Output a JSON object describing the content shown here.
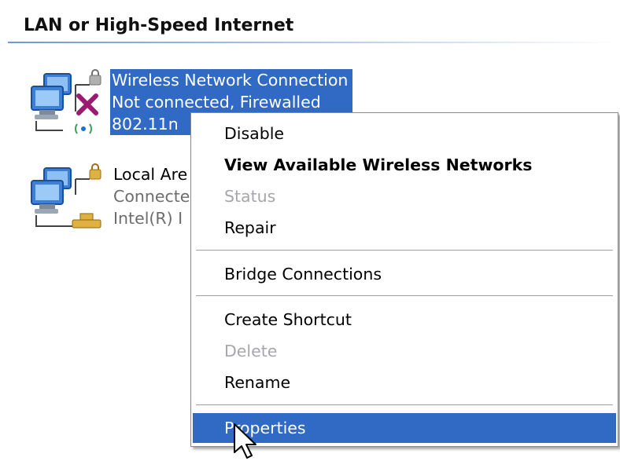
{
  "section": {
    "title": "LAN or High-Speed Internet"
  },
  "connections": [
    {
      "name": "Wireless Network Connection",
      "status": "Not connected, Firewalled",
      "device": "802.11n",
      "selected": true,
      "icon": "wireless-network-icon"
    },
    {
      "name": "Local Are",
      "status": "Connecte",
      "device": "Intel(R) I",
      "selected": false,
      "icon": "lan-network-icon"
    }
  ],
  "context_menu": {
    "items": [
      {
        "label": "Disable",
        "bold": false,
        "disabled": false
      },
      {
        "label": "View Available Wireless Networks",
        "bold": true,
        "disabled": false
      },
      {
        "label": "Status",
        "bold": false,
        "disabled": true
      },
      {
        "label": "Repair",
        "bold": false,
        "disabled": false
      },
      {
        "label": "Bridge Connections",
        "bold": false,
        "disabled": false
      },
      {
        "label": "Create Shortcut",
        "bold": false,
        "disabled": false
      },
      {
        "label": "Delete",
        "bold": false,
        "disabled": true
      },
      {
        "label": "Rename",
        "bold": false,
        "disabled": false
      },
      {
        "label": "Properties",
        "bold": false,
        "disabled": false,
        "highlighted": true
      }
    ]
  },
  "colors": {
    "selection": "#316ac5",
    "disabled_text": "#a7a6aa",
    "header_line": "#6f97d6"
  },
  "cursor": {
    "icon": "arrow-pointer-icon"
  }
}
